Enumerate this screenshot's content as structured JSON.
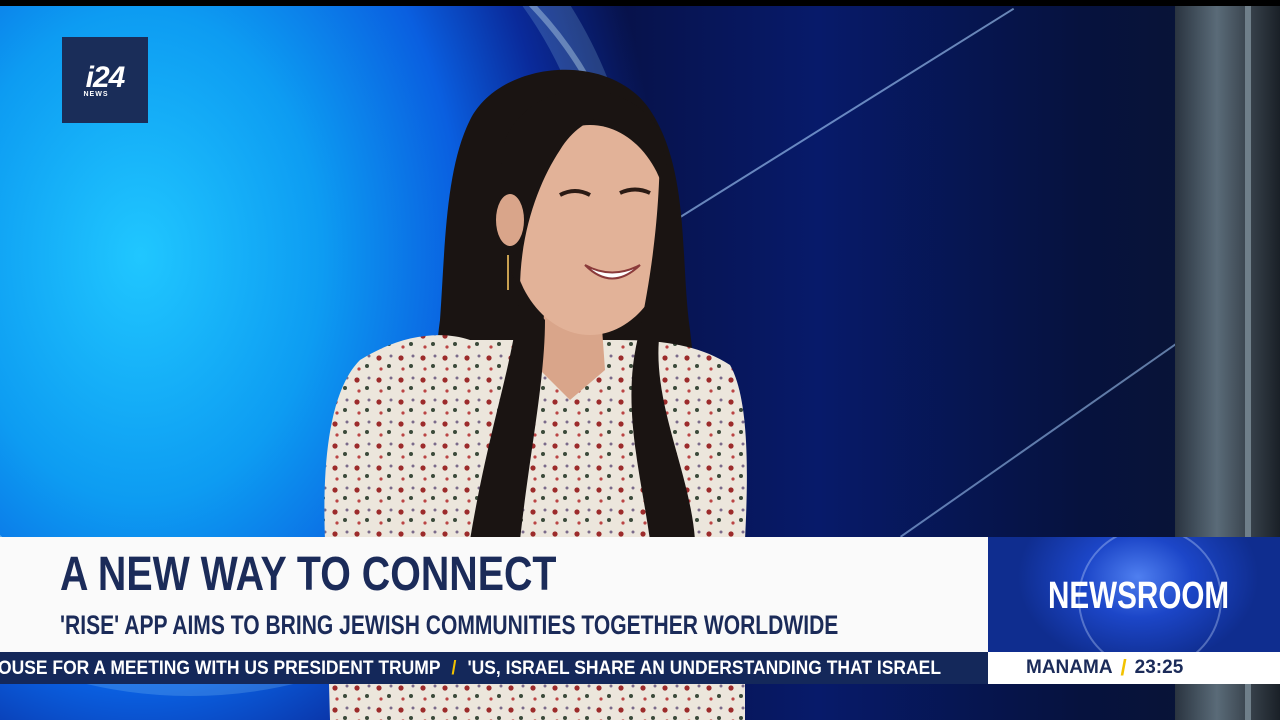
{
  "channel": {
    "logo_text": "i24",
    "logo_sub": "NEWS",
    "brand_color": "#1a2d59",
    "accent_color": "#f2c200"
  },
  "lower_third": {
    "headline": "A NEW WAY TO CONNECT",
    "subheadline": "'RISE'  APP AIMS TO BRING JEWISH COMMUNITIES TOGETHER WORLDWIDE"
  },
  "program": {
    "name": "NEWSROOM"
  },
  "ticker": {
    "items": [
      "OUSE FOR A MEETING WITH US PRESIDENT TRUMP",
      "'US, ISRAEL SHARE AN UNDERSTANDING THAT ISRAEL"
    ]
  },
  "clock": {
    "city": "MANAMA",
    "time": "23:25"
  }
}
